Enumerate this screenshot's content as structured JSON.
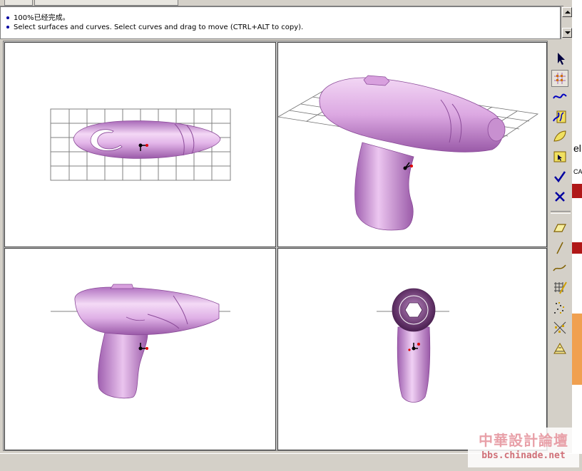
{
  "messages": [
    "100%已经完成。",
    "Select surfaces and curves.  Select curves and drag to move (CTRL+ALT to copy)."
  ],
  "viewports": [
    {
      "name": "top-view"
    },
    {
      "name": "perspective-view"
    },
    {
      "name": "front-view"
    },
    {
      "name": "right-view"
    }
  ],
  "toolbar": {
    "tools": [
      "select-arrow-icon",
      "select-points-icon",
      "select-curve-icon",
      "select-surface-curve-icon",
      "select-surface-icon",
      "select-polysurface-icon",
      "ok-check-icon",
      "cancel-x-icon",
      "plane-icon",
      "line-icon",
      "curve-icon",
      "surface-grid-icon",
      "point-cloud-icon",
      "scatter-points-icon",
      "dimension-icon"
    ]
  },
  "side_fragments": {
    "text1": "el",
    "text2": "CA"
  },
  "watermark": {
    "title": "中華設計論壇",
    "url": "bbs.chinade.net"
  },
  "colors": {
    "model": "#d9a3e0",
    "model_dark": "#9a5aa8",
    "grid": "#808080",
    "message_bullet": "#0000a0"
  }
}
